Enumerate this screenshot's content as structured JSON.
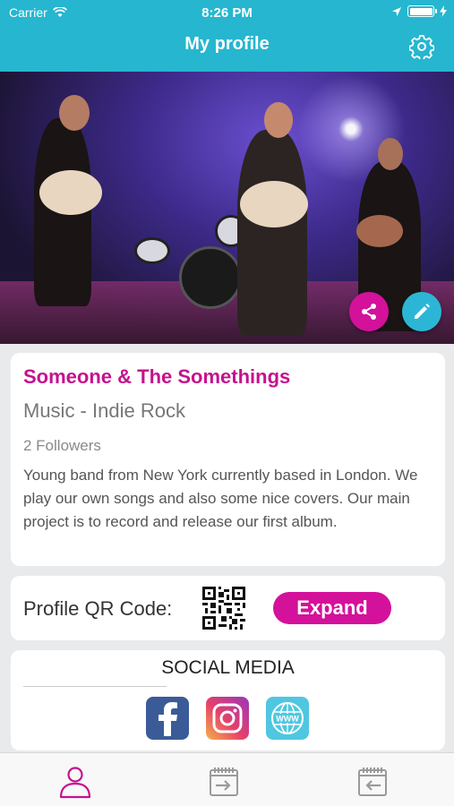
{
  "status_bar": {
    "carrier": "Carrier",
    "time": "8:26 PM"
  },
  "nav": {
    "title": "My profile",
    "settings_icon": "gear-icon"
  },
  "photo": {
    "actions": [
      "share-icon",
      "edit-icon"
    ]
  },
  "profile": {
    "name": "Someone & The Somethings",
    "genre": "Music - Indie Rock",
    "followers": "2 Followers",
    "bio": "Young band from New York currently based in London. We play our own songs and also some nice covers. Our main project is to record and release our first album."
  },
  "qr": {
    "label": "Profile QR Code:",
    "expand_label": "Expand"
  },
  "social": {
    "title": "SOCIAL MEDIA",
    "icons": [
      "facebook-icon",
      "instagram-icon",
      "website-icon"
    ]
  },
  "tabbar": {
    "tabs": [
      "profile-icon",
      "calendar-in-icon",
      "calendar-out-icon"
    ]
  },
  "colors": {
    "header": "#26b6cf",
    "accent": "#c6118f",
    "edit": "#2cb6d5"
  }
}
